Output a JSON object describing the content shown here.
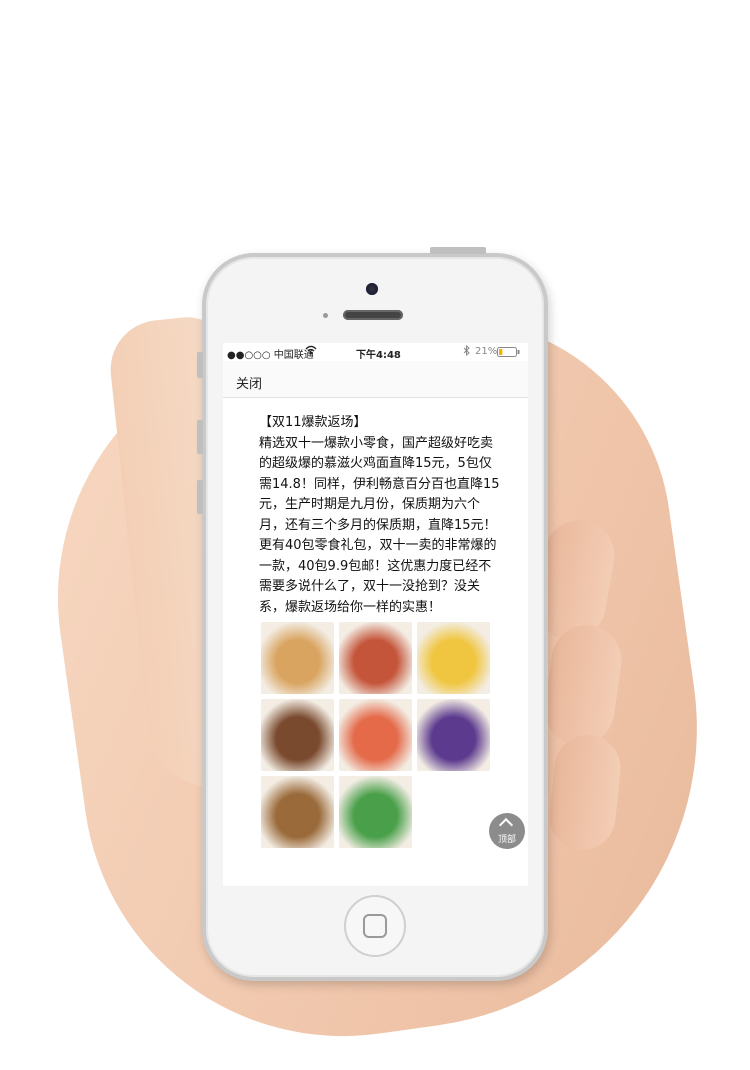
{
  "status_bar": {
    "carrier": "●●○○○ 中国联通",
    "wifi": "wifi-icon",
    "time": "下午4:48",
    "bluetooth": "bluetooth-icon",
    "battery_percent": "21%",
    "battery_level": 0.21
  },
  "nav": {
    "close_label": "关闭"
  },
  "article": {
    "title": "【双11爆款返场】",
    "body": "精选双十一爆款小零食，国产超级好吃卖的超级爆的慕滋火鸡面直降15元，5包仅需14.8！同样，伊利畅意百分百也直降15元，生产时期是九月份，保质期为六个月，还有三个多月的保质期，直降15元！更有40包零食礼包，双十一卖的非常爆的一款，40包9.9包邮！这优惠力度已经不需要多说什么了，双十一没抢到？没关系，爆款返场给你一样的实惠！"
  },
  "images": [
    {
      "name": "product-image-snack-balls",
      "color": "#d9a460"
    },
    {
      "name": "product-image-noodles",
      "color": "#c4553a"
    },
    {
      "name": "product-image-wafer-snacks",
      "color": "#f0c640"
    },
    {
      "name": "product-image-chocolate-cake",
      "color": "#7a4a2e"
    },
    {
      "name": "product-image-snack-gift-pack",
      "color": "#e46a4a"
    },
    {
      "name": "product-image-chocolate-candy",
      "color": "#5c3a8e"
    },
    {
      "name": "product-image-bread",
      "color": "#9a6a3a"
    },
    {
      "name": "product-image-yogurt-drink",
      "color": "#4aa04a"
    }
  ],
  "back_to_top": {
    "label": "顶部",
    "icon": "chevron-up-icon"
  }
}
